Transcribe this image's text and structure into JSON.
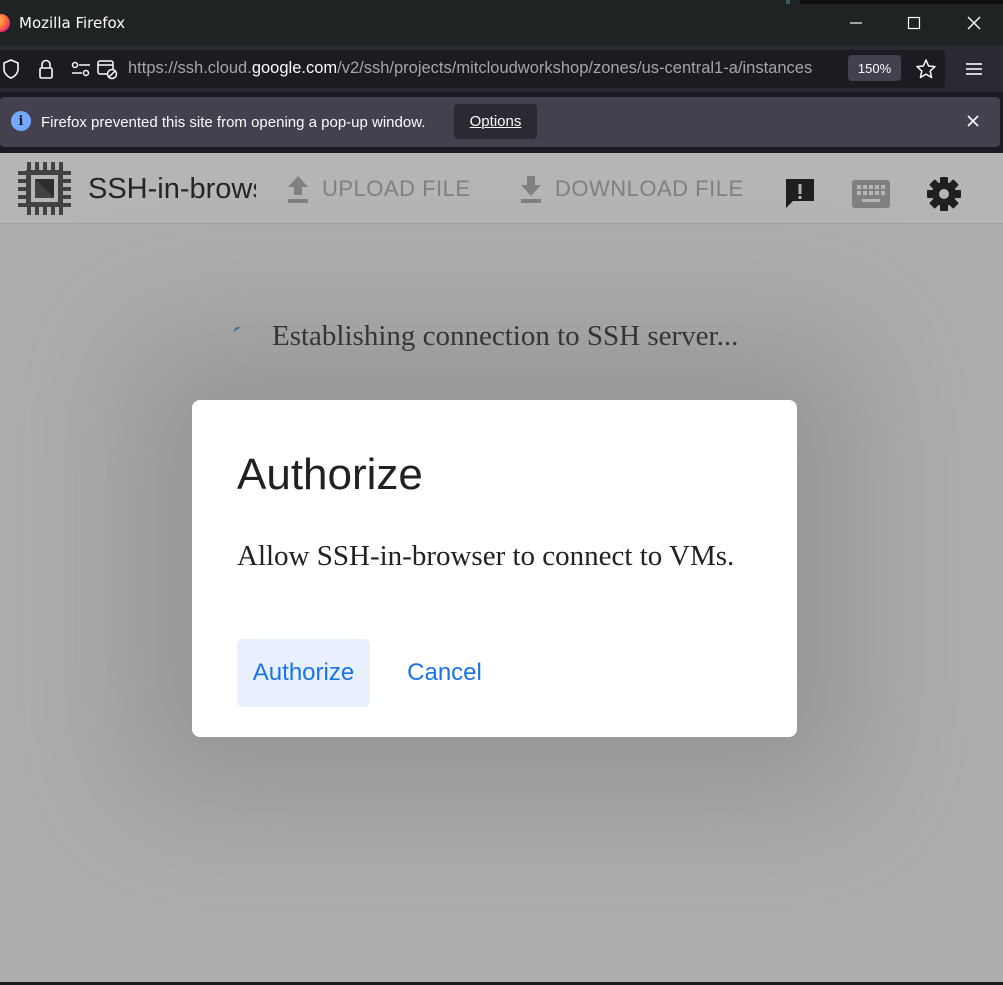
{
  "window": {
    "title": "Mozilla Firefox"
  },
  "navbar": {
    "url_prefix": "https://ssh.cloud.",
    "url_host": "google.com",
    "url_rest": "/v2/ssh/projects/mitcloudworkshop/zones/us-central1-a/instances",
    "zoom": "150%"
  },
  "notification": {
    "message": "Firefox prevented this site from opening a pop-up window.",
    "options_label": "Options"
  },
  "app": {
    "title": "SSH-in-browser",
    "upload_label": "UPLOAD FILE",
    "download_label": "DOWNLOAD FILE",
    "status": "Establishing connection to SSH server..."
  },
  "dialog": {
    "title": "Authorize",
    "body": "Allow SSH-in-browser to connect to VMs.",
    "authorize_label": "Authorize",
    "cancel_label": "Cancel"
  },
  "colors": {
    "accent": "#1a73e8",
    "dialog_bg": "#ffffff",
    "browser_chrome": "#2b2a33"
  }
}
